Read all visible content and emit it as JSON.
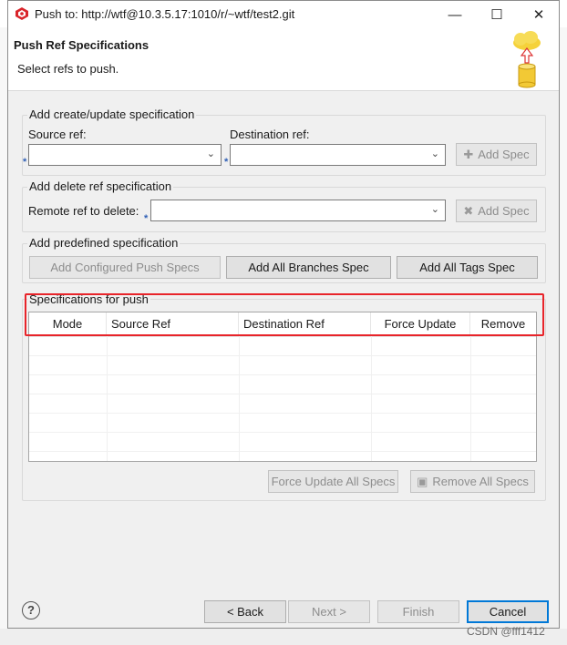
{
  "window": {
    "title": "Push to: http://wtf@10.3.5.17:1010/r/~wtf/test2.git",
    "minimize_glyph": "—",
    "maximize_glyph": "☐",
    "close_glyph": "✕"
  },
  "header": {
    "title": "Push Ref Specifications",
    "description": "Select refs to push."
  },
  "create_update": {
    "group_label": "Add create/update specification",
    "source_label": "Source ref:",
    "destination_label": "Destination ref:",
    "source_value": "",
    "destination_value": "",
    "add_spec_label": "Add Spec",
    "required_marker": "*"
  },
  "delete_spec": {
    "group_label": "Add delete ref specification",
    "remote_label": "Remote ref to delete:",
    "remote_value": "",
    "add_spec_label": "Add Spec",
    "required_marker": "*"
  },
  "predefined": {
    "group_label": "Add predefined specification",
    "configured_label": "Add Configured Push Specs",
    "all_branches_label": "Add All Branches Spec",
    "all_tags_label": "Add All Tags Spec"
  },
  "specs": {
    "group_label": "Specifications for push",
    "columns": [
      "Mode",
      "Source Ref",
      "Destination Ref",
      "Force Update",
      "Remove"
    ],
    "rows": [],
    "force_update_all_label": "Force Update All Specs",
    "remove_all_label": "Remove All Specs"
  },
  "footer": {
    "help_glyph": "?",
    "back_label": "< Back",
    "next_label": "Next >",
    "finish_label": "Finish",
    "cancel_label": "Cancel"
  },
  "watermark": "CSDN @fff1412",
  "colors": {
    "highlight": "#e8242a",
    "default_button_border": "#0078d7",
    "required_marker": "#2f5fb5"
  }
}
